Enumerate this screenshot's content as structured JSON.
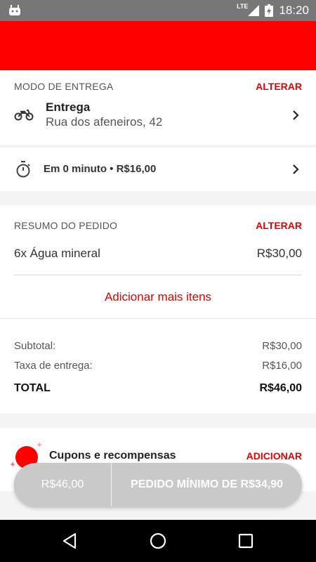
{
  "status_bar": {
    "network": "LTE",
    "time": "18:20"
  },
  "delivery": {
    "section_label": "MODO DE ENTREGA",
    "change_label": "ALTERAR",
    "mode": "Entrega",
    "address": "Rua dos afeneiros, 42"
  },
  "timing": {
    "text": "Em 0 minuto • R$16,00"
  },
  "order_summary": {
    "section_label": "RESUMO DO PEDIDO",
    "change_label": "ALTERAR",
    "items": [
      {
        "name": "6x Água mineral",
        "price": "R$30,00"
      }
    ],
    "add_more_label": "Adicionar mais itens"
  },
  "totals": {
    "subtotal_label": "Subtotal:",
    "subtotal_value": "R$30,00",
    "delivery_fee_label": "Taxa de entrega:",
    "delivery_fee_value": "R$16,00",
    "total_label": "TOTAL",
    "total_value": "R$46,00"
  },
  "coupons": {
    "title": "Cupons e recompensas",
    "add_label": "ADICIONAR"
  },
  "checkout": {
    "price": "R$46,00",
    "label": "PEDIDO MÍNIMO DE R$34,90"
  },
  "colors": {
    "accent": "#ff0000",
    "link": "#e60000",
    "button_disabled": "#c9c9c9"
  },
  "icons": {
    "motorcycle": "motorcycle-icon",
    "timer": "timer-icon",
    "chevron": "chevron-right-icon",
    "coupon": "coupon-badge-icon",
    "back": "nav-back-icon",
    "home": "nav-home-icon",
    "recents": "nav-recents-icon"
  }
}
